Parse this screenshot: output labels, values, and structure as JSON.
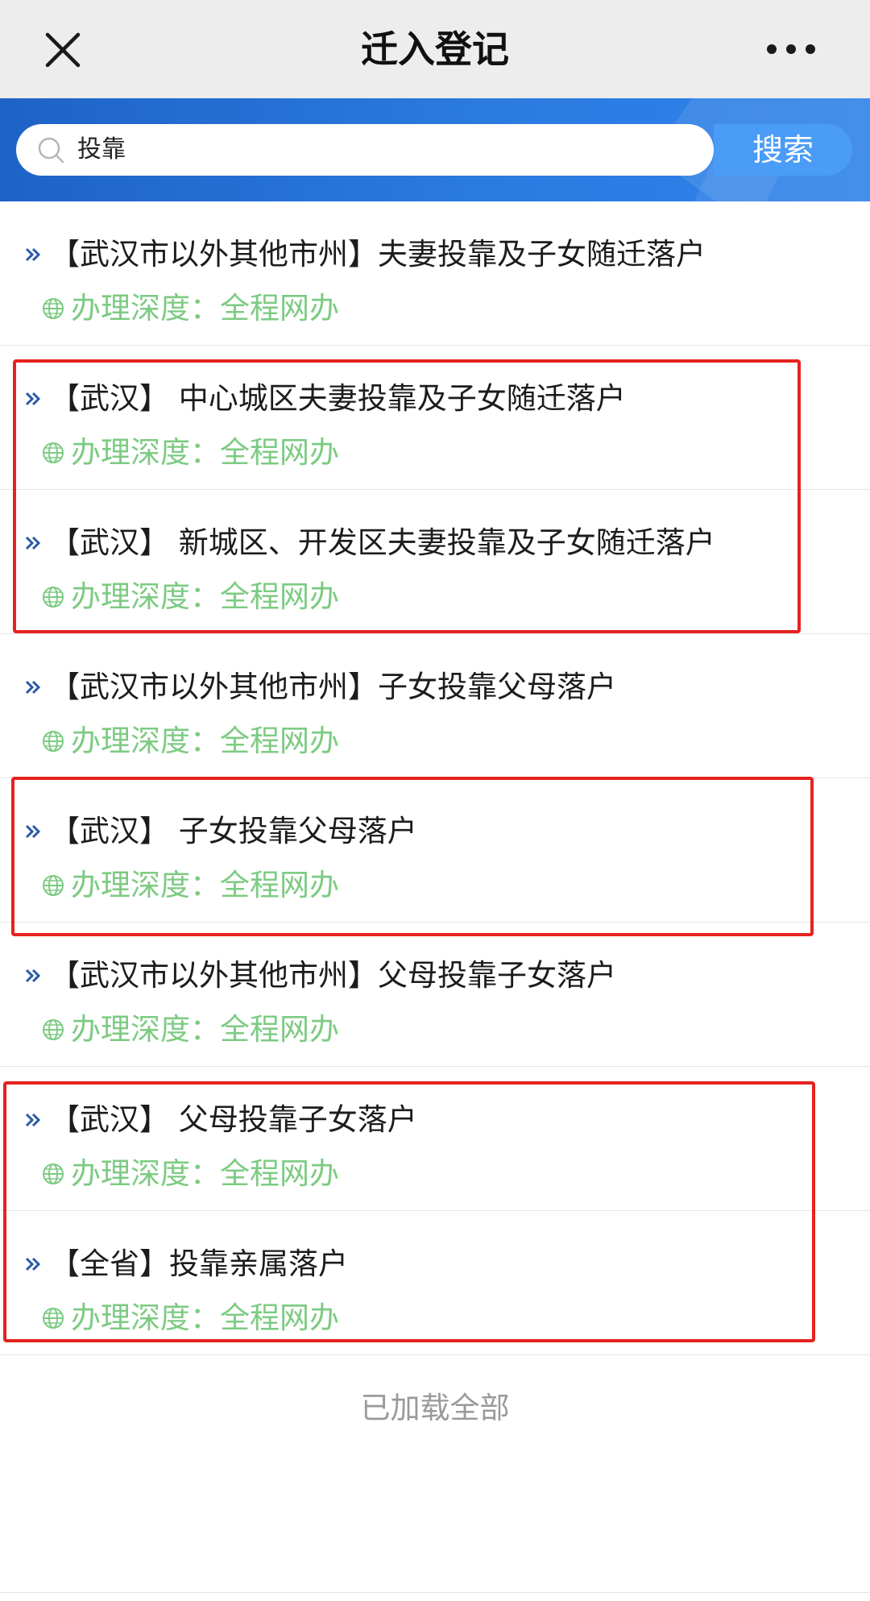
{
  "navbar": {
    "title": "迁入登记",
    "close_icon": "close-icon",
    "more_icon": "more-dots-icon"
  },
  "search": {
    "value": "投靠",
    "button_label": "搜索",
    "icon": "search-icon"
  },
  "colors": {
    "banner": "#2b7ae0",
    "search_button": "#4a9cf6",
    "depth_text": "#7ccb82",
    "annotation": "#e5231f"
  },
  "items": [
    {
      "title": "【武汉市以外其他市州】夫妻投靠及子女随迁落户",
      "depth": "办理深度：全程网办"
    },
    {
      "title": "【武汉】 中心城区夫妻投靠及子女随迁落户",
      "depth": "办理深度：全程网办"
    },
    {
      "title": "【武汉】 新城区、开发区夫妻投靠及子女随迁落户",
      "depth": "办理深度：全程网办"
    },
    {
      "title": "【武汉市以外其他市州】子女投靠父母落户",
      "depth": "办理深度：全程网办"
    },
    {
      "title": "【武汉】 子女投靠父母落户",
      "depth": "办理深度：全程网办"
    },
    {
      "title": "【武汉市以外其他市州】父母投靠子女落户",
      "depth": "办理深度：全程网办"
    },
    {
      "title": "【武汉】 父母投靠子女落户",
      "depth": "办理深度：全程网办"
    },
    {
      "title": "【全省】投靠亲属落户",
      "depth": "办理深度：全程网办"
    }
  ],
  "footer": {
    "status": "已加载全部"
  }
}
